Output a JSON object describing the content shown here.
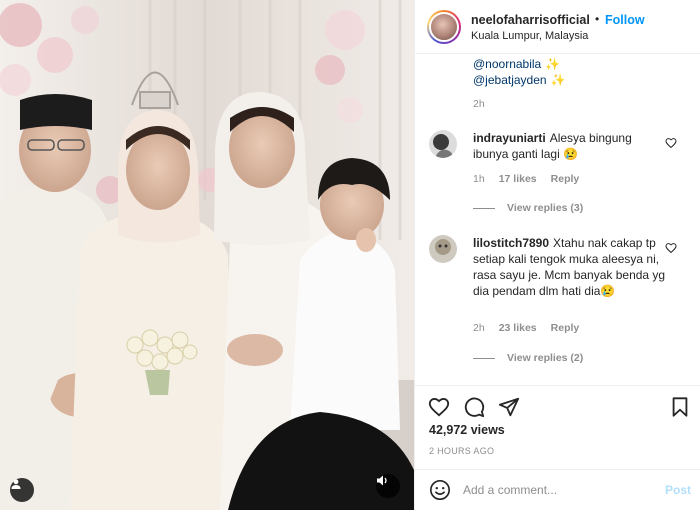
{
  "header": {
    "username": "neelofaharrisofficial",
    "separator": "•",
    "follow_label": "Follow",
    "location": "Kuala Lumpur, Malaysia"
  },
  "caption": {
    "mentions": [
      "@noornabila",
      "@jebatjayden"
    ],
    "mention_emoji": "✨",
    "time": "2h"
  },
  "comments": [
    {
      "username": "indrayuniarti",
      "text": "Alesya bingung ibunya ganti lagi",
      "emoji": "😢",
      "time": "1h",
      "likes": "17 likes",
      "reply_label": "Reply",
      "view_replies": "View replies (3)"
    },
    {
      "username": "lilostitch7890",
      "text": "Xtahu nak cakap tp setiap kali tengok muka aleesya ni, rasa sayu je. Mcm banyak benda yg dia pendam dlm hati dia",
      "emoji": "😢",
      "time": "2h",
      "likes": "23 likes",
      "reply_label": "Reply",
      "view_replies": "View replies (2)"
    }
  ],
  "stats": {
    "views": "42,972 views",
    "posted": "2 HOURS AGO"
  },
  "composer": {
    "placeholder": "Add a comment...",
    "post_label": "Post"
  },
  "media": {
    "user_tag_icon": "person-icon",
    "sound_icon": "speaker-icon"
  },
  "colors": {
    "link": "#0095f6",
    "mention": "#00376b",
    "muted": "#8e8e8e",
    "post_disabled": "#b2dffc"
  }
}
